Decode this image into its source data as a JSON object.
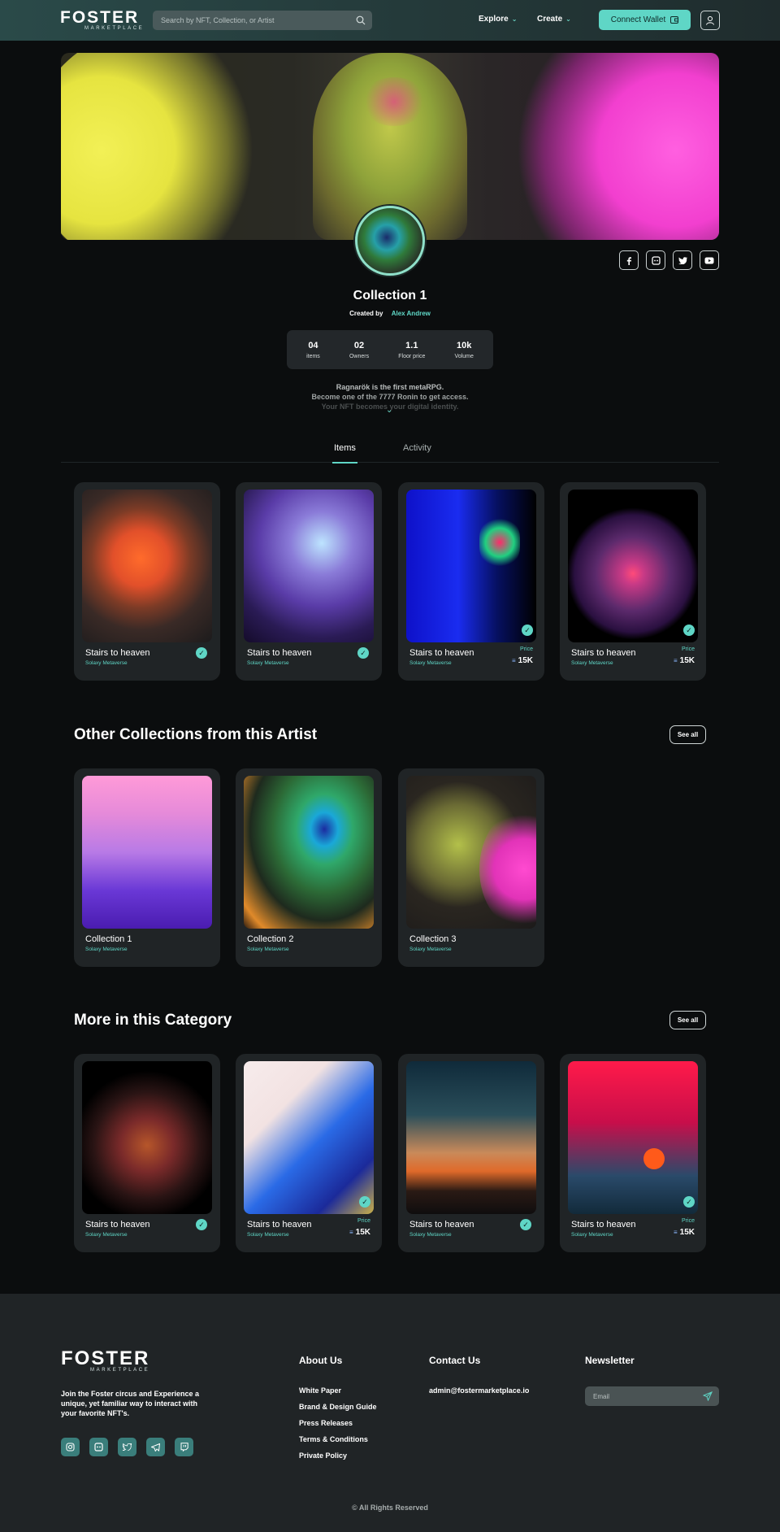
{
  "header": {
    "logo_word": "FOSTER",
    "logo_sub": "MARKETPLACE",
    "search_placeholder": "Search by NFT, Collection, or Artist",
    "nav_explore": "Explore",
    "nav_create": "Create",
    "connect_wallet": "Connect Wallet"
  },
  "collection": {
    "title": "Collection 1",
    "created_by_label": "Created by",
    "creator_name": "Alex Andrew",
    "stats": [
      {
        "value": "04",
        "label": "items"
      },
      {
        "value": "02",
        "label": "Owners"
      },
      {
        "value": "1.1",
        "label": "Floor price"
      },
      {
        "value": "10k",
        "label": "Volume"
      }
    ],
    "description": [
      "Ragnarök is the first metaRPG.",
      "Become one of the 7777 Ronin to get access.",
      "Your NFT becomes your digital identity."
    ]
  },
  "tabs": {
    "items": "Items",
    "activity": "Activity"
  },
  "items": [
    {
      "name": "Stairs to heaven",
      "sub": "Solaxy Metaverse",
      "verified": true
    },
    {
      "name": "Stairs to heaven",
      "sub": "Solaxy Metaverse",
      "verified": true
    },
    {
      "name": "Stairs to heaven",
      "sub": "Solaxy Metaverse",
      "price_label": "Price",
      "price": "15K"
    },
    {
      "name": "Stairs to heaven",
      "sub": "Solaxy Metaverse",
      "price_label": "Price",
      "price": "15K"
    }
  ],
  "other_collections": {
    "title": "Other Collections from this Artist",
    "see_all": "See all",
    "cards": [
      {
        "name": "Collection 1",
        "sub": "Solaxy Metaverse"
      },
      {
        "name": "Collection 2",
        "sub": "Solaxy Metaverse"
      },
      {
        "name": "Collection 3",
        "sub": "Solaxy Metaverse"
      }
    ]
  },
  "category": {
    "title": "More in this Category",
    "see_all": "See all",
    "cards": [
      {
        "name": "Stairs to heaven",
        "sub": "Solaxy Metaverse",
        "verified": true
      },
      {
        "name": "Stairs to heaven",
        "sub": "Solaxy Metaverse",
        "price_label": "Price",
        "price": "15K"
      },
      {
        "name": "Stairs to heaven",
        "sub": "Solaxy Metaverse",
        "verified": true
      },
      {
        "name": "Stairs to heaven",
        "sub": "Solaxy Metaverse",
        "price_label": "Price",
        "price": "15K"
      }
    ]
  },
  "footer": {
    "tagline": "Join the Foster circus and Experience a unique, yet familiar way to interact with your favorite NFT's.",
    "about_title": "About Us",
    "about_links": [
      "White Paper",
      "Brand & Design Guide",
      "Press Releases",
      "Terms & Conditions",
      "Private Policy"
    ],
    "contact_title": "Contact Us",
    "contact_email": "admin@fostermarketplace.io",
    "newsletter_title": "Newsletter",
    "email_placeholder": "Email",
    "copyright": "© All Rights Reserved"
  },
  "colors": {
    "accent": "#5fd6c6",
    "background": "#0b0d0e",
    "card": "#202426"
  }
}
